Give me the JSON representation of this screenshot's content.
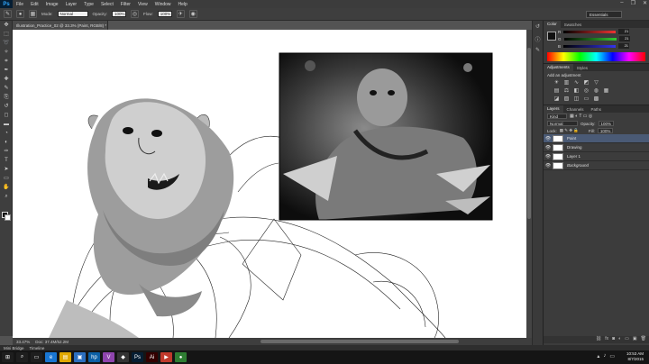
{
  "menubar": {
    "logo": "Ps",
    "items": [
      "File",
      "Edit",
      "Image",
      "Layer",
      "Type",
      "Select",
      "Filter",
      "View",
      "Window",
      "Help"
    ],
    "window_controls": [
      "–",
      "❐",
      "✕"
    ]
  },
  "options": {
    "mode_label": "Mode:",
    "mode_value": "Normal",
    "opacity_label": "Opacity:",
    "opacity_value": "100%",
    "flow_label": "Flow:",
    "flow_value": "100%",
    "workspace": "Essentials"
  },
  "document": {
    "tab_title": "Illustration_Practice_02 @ 33.3% (Paint, RGB/8) *"
  },
  "status": {
    "zoom": "33.47%",
    "doc": "Doc: 37.4M/52.2M"
  },
  "bridge": {
    "tabs": [
      "Mini Bridge",
      "Timeline"
    ]
  },
  "color_panel": {
    "tabs": [
      "Color",
      "Swatches"
    ],
    "rows": [
      {
        "label": "R",
        "value": "21"
      },
      {
        "label": "G",
        "value": "21"
      },
      {
        "label": "B",
        "value": "21"
      }
    ]
  },
  "adjustments": {
    "tabs": [
      "Adjustments",
      "Styles"
    ],
    "title": "Add an adjustment"
  },
  "layers": {
    "tabs": [
      "Layers",
      "Channels",
      "Paths"
    ],
    "kind": "Kind",
    "blend": "Normal",
    "opacity_label": "Opacity:",
    "opacity": "100%",
    "lock_label": "Lock:",
    "fill_label": "Fill:",
    "fill": "100%",
    "items": [
      {
        "name": "Paint",
        "selected": true
      },
      {
        "name": "Drawing",
        "selected": false
      },
      {
        "name": "Layer 1",
        "selected": false
      },
      {
        "name": "Background",
        "selected": false
      }
    ]
  },
  "taskbar": {
    "icons": [
      {
        "name": "windows-icon",
        "glyph": "⊞",
        "color": "#1e1e1e"
      },
      {
        "name": "search-icon",
        "glyph": "⌕",
        "color": "#1e1e1e"
      },
      {
        "name": "taskview-icon",
        "glyph": "▭",
        "color": "#1e1e1e"
      },
      {
        "name": "edge-icon",
        "glyph": "e",
        "color": "#1976d2"
      },
      {
        "name": "explorer-icon",
        "glyph": "▤",
        "color": "#e0a800"
      },
      {
        "name": "store-icon",
        "glyph": "▣",
        "color": "#2c6fbf"
      },
      {
        "name": "hp-icon",
        "glyph": "hp",
        "color": "#0b5fa5"
      },
      {
        "name": "vivaldi-icon",
        "glyph": "V",
        "color": "#8e44ad"
      },
      {
        "name": "app-icon",
        "glyph": "◆",
        "color": "#333"
      },
      {
        "name": "photoshop-icon",
        "glyph": "Ps",
        "color": "#061e33"
      },
      {
        "name": "illustrator-icon",
        "glyph": "Ai",
        "color": "#330000"
      },
      {
        "name": "media-icon",
        "glyph": "▶",
        "color": "#c0392b"
      },
      {
        "name": "chrome-icon",
        "glyph": "●",
        "color": "#2e7d32"
      }
    ],
    "time": "10:53 AM",
    "date": "8/7/2015"
  }
}
